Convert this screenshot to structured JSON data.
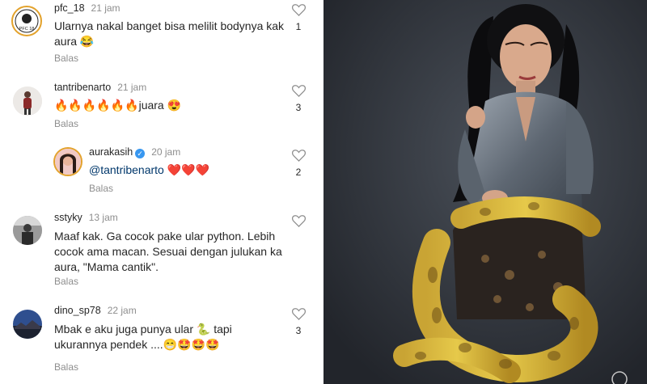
{
  "comments": [
    {
      "user": "pfc_18",
      "time": "21 jam",
      "text": "Ularnya nakal banget bisa melilit bodynya kak aura 😂",
      "reply": "Balas",
      "likes": "1",
      "avatar_text": "PFC 18"
    },
    {
      "user": "tantribenarto",
      "time": "21 jam",
      "text": "🔥🔥🔥🔥🔥🔥juara 😍",
      "reply": "Balas",
      "likes": "3"
    },
    {
      "user": "aurakasih",
      "time": "20 jam",
      "mention": "@tantribenarto",
      "text": " ❤️❤️❤️",
      "reply": "Balas",
      "likes": "2",
      "verified_mark": "✓"
    },
    {
      "user": "sstyky",
      "time": "13 jam",
      "text": "Maaf kak. Ga cocok pake ular python. Lebih cocok ama macan. Sesuai dengan julukan ka aura, \"Mama cantik\".",
      "reply": "Balas",
      "likes": ""
    },
    {
      "user": "dino_sp78",
      "time": "22 jam",
      "text": "Mbak e aku juga punya ular 🐍 tapi ukurannya pendek ....😁🤩🤩🤩",
      "reply": "Balas",
      "likes": "3"
    }
  ],
  "colors": {
    "text": "#262626",
    "muted": "#8e8e8e",
    "mention": "#00376b",
    "verified": "#3897f0"
  }
}
